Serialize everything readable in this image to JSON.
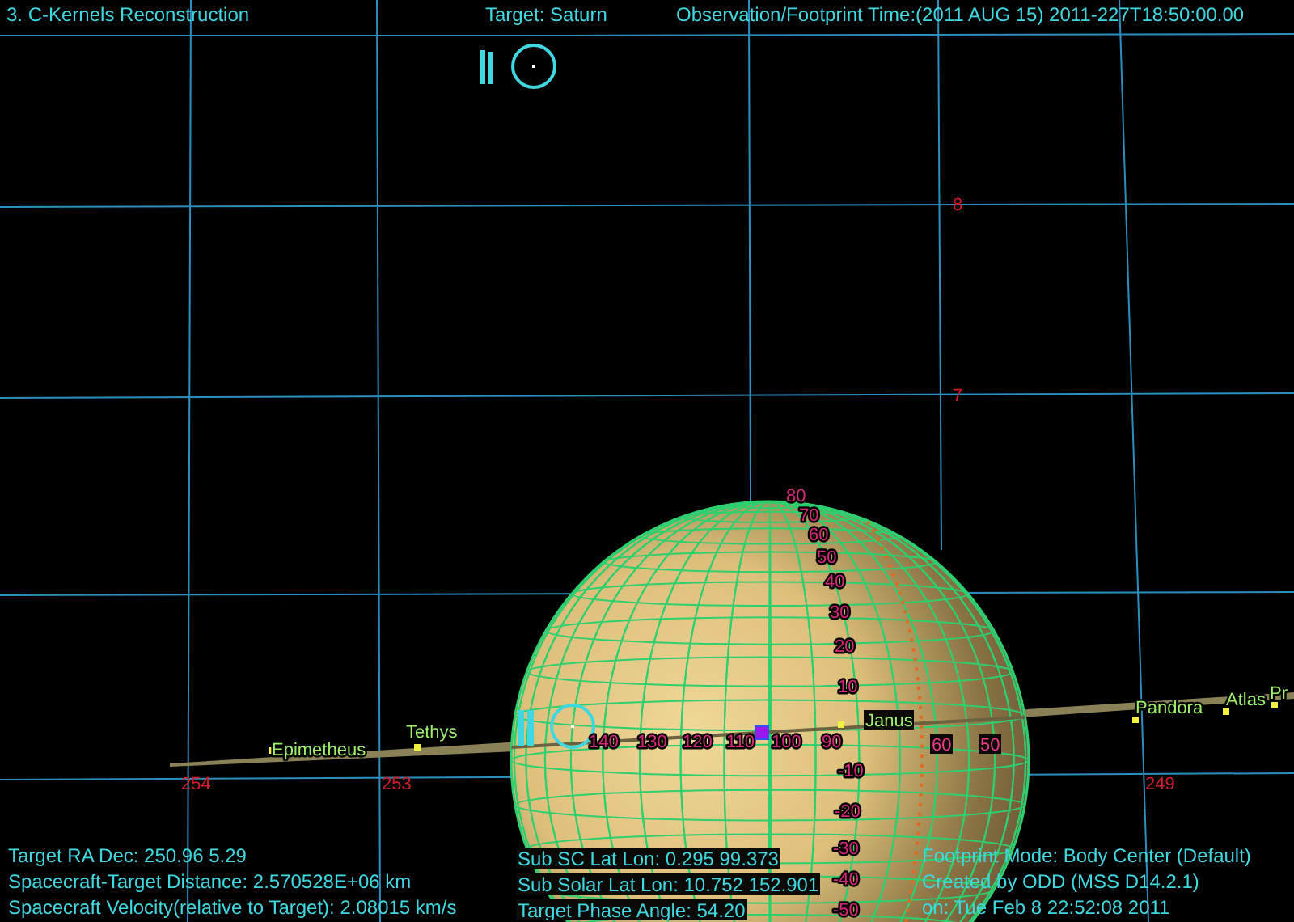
{
  "header": {
    "title": "3. C-Kernels Reconstruction",
    "target": "Target: Saturn",
    "time": "Observation/Footprint Time:(2011 AUG 15) 2011-227T18:50:00.00"
  },
  "sky_grid": {
    "ra_labels": [
      "254",
      "253",
      "249"
    ],
    "dec_labels": [
      "8",
      "7"
    ]
  },
  "moons": [
    {
      "name": "Epimetheus"
    },
    {
      "name": "Tethys"
    },
    {
      "name": "Janus"
    },
    {
      "name": "Pandora"
    },
    {
      "name": "Atlas"
    },
    {
      "name": "Pr"
    }
  ],
  "planet": {
    "latitude_labels": [
      "80",
      "70",
      "60",
      "50",
      "40",
      "30",
      "20",
      "10",
      "-10",
      "-20",
      "-30",
      "-40",
      "-50"
    ],
    "longitude_labels": [
      "140",
      "130",
      "120",
      "110",
      "100",
      "90",
      "60",
      "50"
    ]
  },
  "info_left": [
    "Target RA Dec: 250.96    5.29",
    "Spacecraft-Target Distance: 2.570528E+06 km",
    "Spacecraft Velocity(relative to Target): 2.08015 km/s"
  ],
  "info_center": [
    "Sub SC Lat Lon: 0.295  99.373",
    "Sub Solar Lat Lon: 10.752  152.901",
    "Target Phase Angle: 54.20"
  ],
  "info_right": [
    "Footprint Mode: Body Center (Default)",
    "Created by ODD (MSS D14.2.1)",
    "on: Tue Feb  8 22:52:08 2011"
  ]
}
